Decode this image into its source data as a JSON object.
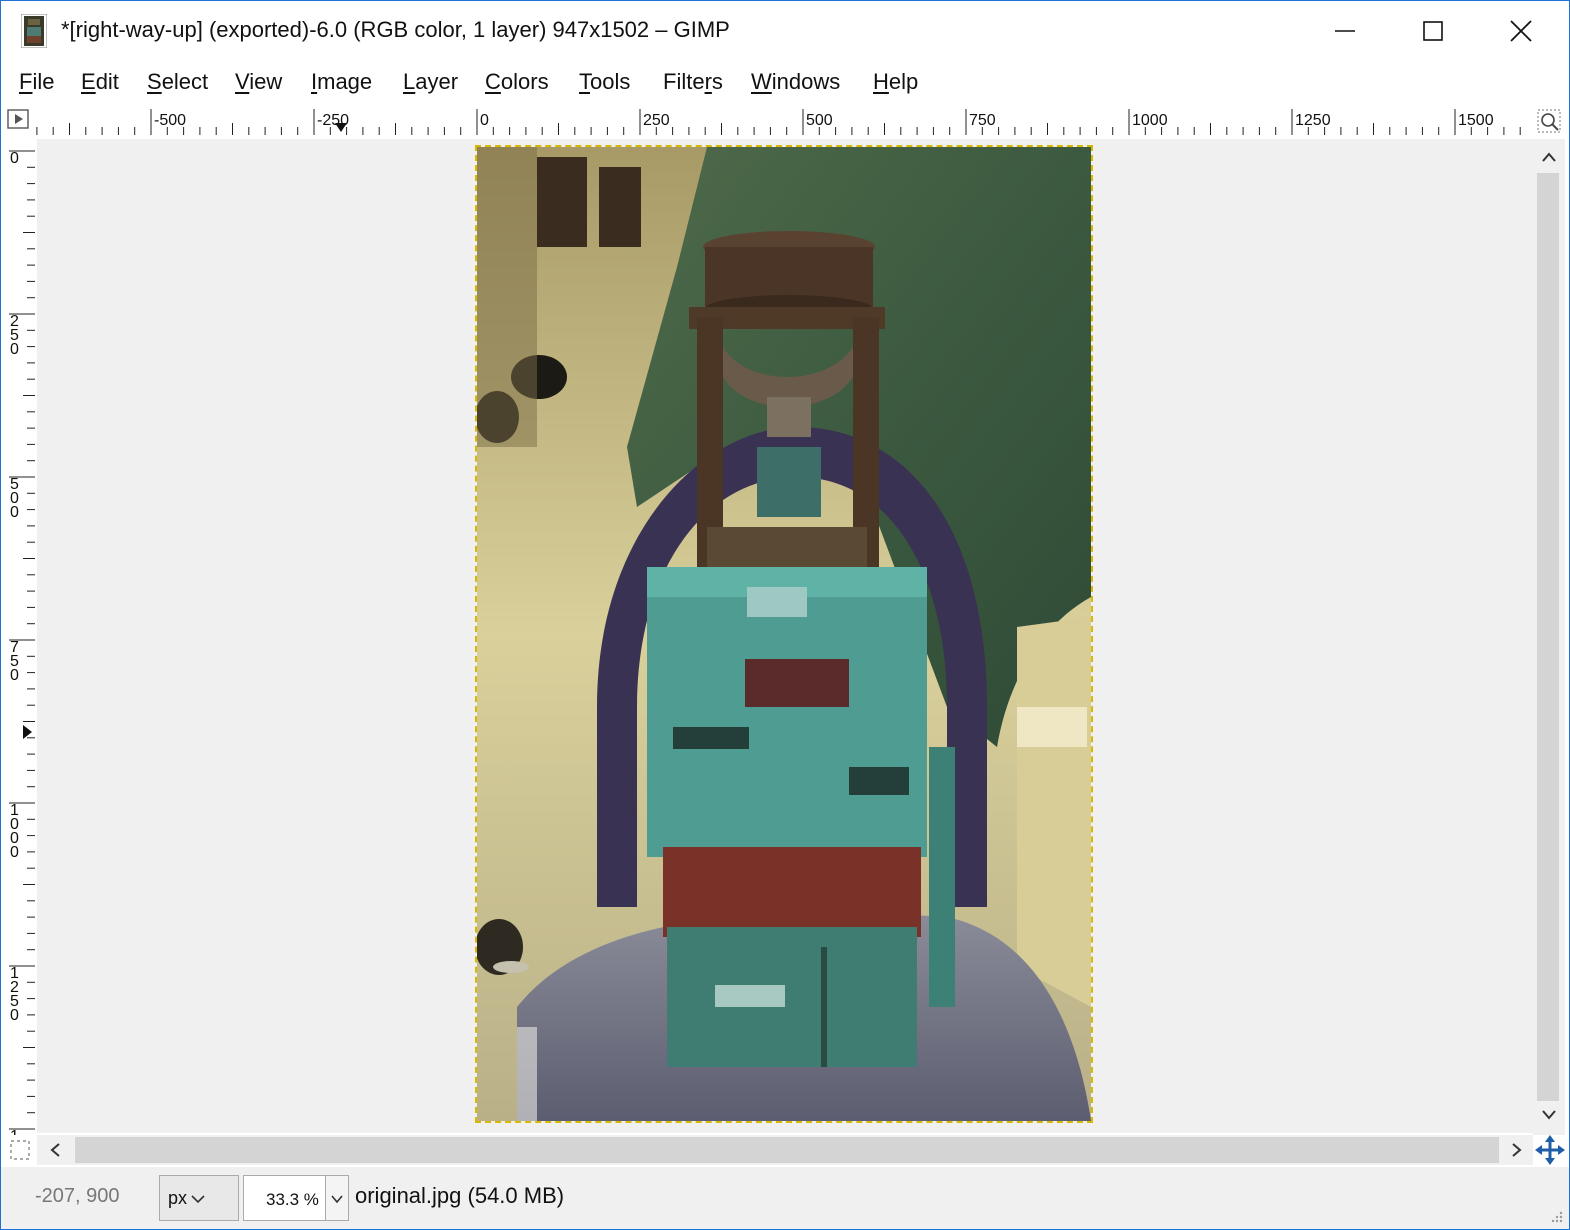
{
  "window": {
    "title": "*[right-way-up] (exported)-6.0 (RGB color, 1 layer) 947x1502 – GIMP",
    "controls": [
      "minimize",
      "maximize",
      "close"
    ]
  },
  "menu": {
    "items": [
      {
        "label": "File",
        "mnemonic": "F"
      },
      {
        "label": "Edit",
        "mnemonic": "E"
      },
      {
        "label": "Select",
        "mnemonic": "S"
      },
      {
        "label": "View",
        "mnemonic": "V"
      },
      {
        "label": "Image",
        "mnemonic": "I"
      },
      {
        "label": "Layer",
        "mnemonic": "L"
      },
      {
        "label": "Colors",
        "mnemonic": "C"
      },
      {
        "label": "Tools",
        "mnemonic": "T"
      },
      {
        "label": "Filters",
        "mnemonic": "r"
      },
      {
        "label": "Windows",
        "mnemonic": "W"
      },
      {
        "label": "Help",
        "mnemonic": "H"
      }
    ]
  },
  "rulers": {
    "horizontal_labels": [
      "-500",
      "-250",
      "0",
      "250",
      "500",
      "750",
      "1000",
      "1250",
      "1500"
    ],
    "vertical_labels": [
      "0",
      "250",
      "500",
      "750",
      "1000",
      "1250",
      "1"
    ]
  },
  "canvas": {
    "image_description_icon": "photo-of-machine",
    "selection_color": "#d9b800"
  },
  "status": {
    "pointer_coords": "-207, 900",
    "unit": "px",
    "zoom": "33.3 %",
    "file_info": "original.jpg (54.0 MB)"
  },
  "colors": {
    "accent": "#1e73d2",
    "canvas_bg": "#f0f0f0",
    "scroll_thumb": "#d4d4d4"
  }
}
